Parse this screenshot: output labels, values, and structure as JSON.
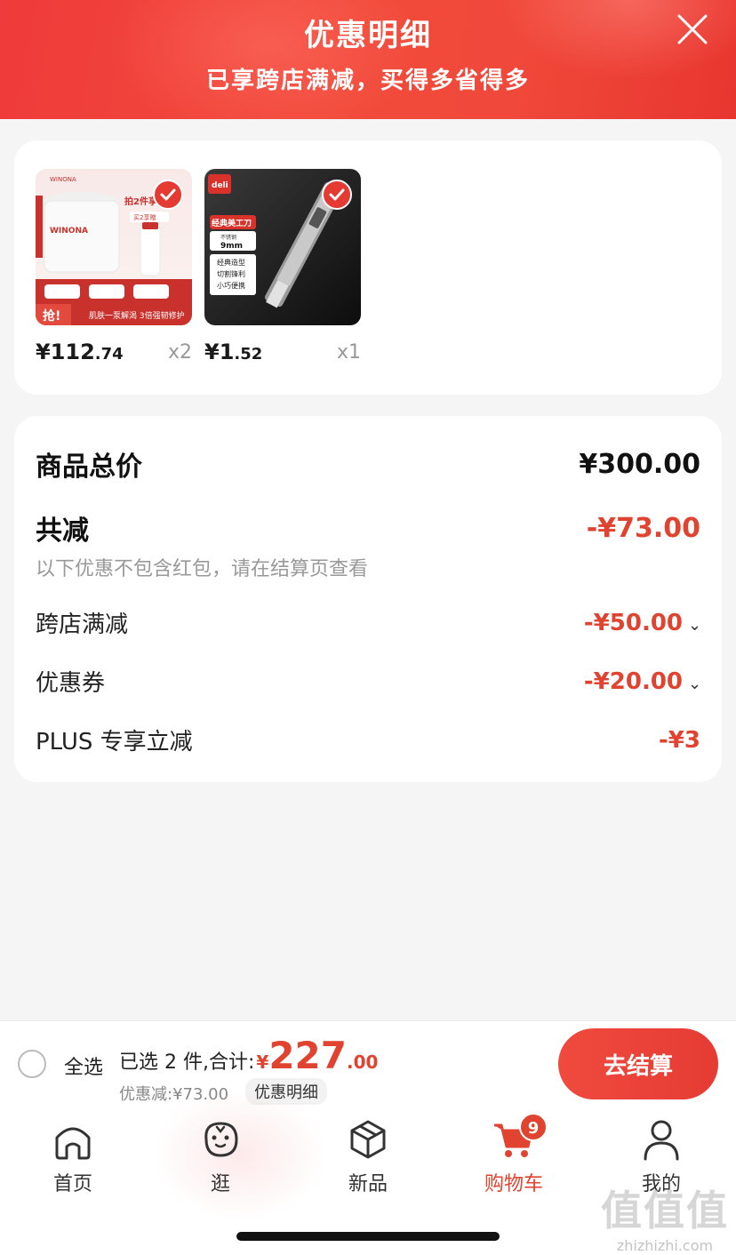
{
  "header": {
    "title": "优惠明细",
    "subtitle": "已享跨店满减，买得多省得多"
  },
  "products": [
    {
      "price_int": "¥112",
      "price_dec": ".74",
      "qty": "x2",
      "image_text": [
        "WINONA",
        "拍2件享超值",
        "买2享赠",
        "抢!",
        "肌肤一泵解渴 3倍强韧修护"
      ]
    },
    {
      "price_int": "¥1",
      "price_dec": ".52",
      "qty": "x1",
      "image_text": [
        "deli",
        "经典美工刀",
        "不锈钢",
        "9mm",
        "经典造型",
        "切割锋利",
        "小巧便携"
      ]
    }
  ],
  "summary": {
    "total_label": "商品总价",
    "total_value": "¥300.00",
    "reduce_label": "共减",
    "reduce_value": "-¥73.00",
    "note": "以下优惠不包含红包，请在结算页查看",
    "items": [
      {
        "label": "跨店满减",
        "value": "-¥50.00"
      },
      {
        "label": "优惠券",
        "value": "-¥20.00"
      },
      {
        "label": "PLUS 专享立减",
        "value": "-¥3"
      }
    ]
  },
  "bottom": {
    "select_all": "全选",
    "selected_text": "已选 2 件,合计:",
    "currency": "¥",
    "amount_int": "227",
    "amount_dec": ".00",
    "saving": "优惠减:¥73.00",
    "detail_link": "优惠明细",
    "checkout": "去结算"
  },
  "tabs": [
    {
      "label": "首页",
      "icon": "home-icon"
    },
    {
      "label": "逛",
      "icon": "explore-face-icon"
    },
    {
      "label": "新品",
      "icon": "cube-icon"
    },
    {
      "label": "购物车",
      "icon": "cart-icon",
      "badge": "9",
      "active": true
    },
    {
      "label": "我的",
      "icon": "user-icon"
    }
  ],
  "watermark": {
    "big": "值值值",
    "small": "zhizhizhi.com"
  },
  "colors": {
    "accent": "#e0432f",
    "header": "#ef3b3b",
    "background": "#f5f5f5"
  }
}
